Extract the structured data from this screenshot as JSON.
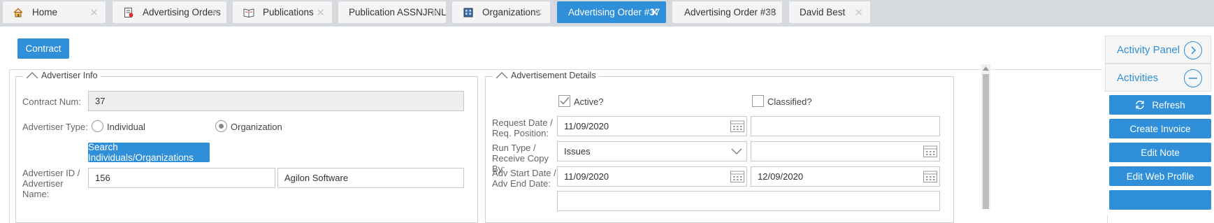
{
  "tabs": [
    {
      "label": "Home",
      "icon": "home-icon"
    },
    {
      "label": "Advertising Orders",
      "icon": "orders-icon"
    },
    {
      "label": "Publications",
      "icon": "publications-icon"
    },
    {
      "label": "Publication ASSNJRNL",
      "icon": ""
    },
    {
      "label": "Organizations",
      "icon": "organizations-icon"
    },
    {
      "label": "Advertising Order #37",
      "icon": "",
      "active": true
    },
    {
      "label": "Advertising Order #38",
      "icon": ""
    },
    {
      "label": "David Best",
      "icon": ""
    }
  ],
  "toolbar": {
    "contract_label": "Contract"
  },
  "advertiser_info": {
    "legend": "Advertiser Info",
    "contract_num_label": "Contract Num:",
    "contract_num_value": "37",
    "advertiser_type_label": "Advertiser Type:",
    "type_individual": "Individual",
    "type_organization": "Organization",
    "selected_type": "Organization",
    "search_button": "Search Individuals/Organizations",
    "advertiser_id_label": "Advertiser ID / Advertiser Name:",
    "advertiser_id_value": "156",
    "advertiser_name_value": "Agilon Software"
  },
  "ad_details": {
    "legend": "Advertisement Details",
    "active_label": "Active?",
    "active_checked": true,
    "classified_label": "Classified?",
    "classified_checked": false,
    "request_date_label": "Request Date / Req. Position:",
    "request_date_value": "11/09/2020",
    "req_position_value": "",
    "run_type_label": "Run Type / Receive Copy By:",
    "run_type_value": "Issues",
    "receive_copy_value": "",
    "adv_dates_label": "Adv Start Date / Adv End Date:",
    "adv_start_value": "11/09/2020",
    "adv_end_value": "12/09/2020"
  },
  "side_panel": {
    "activity_panel_label": "Activity Panel",
    "activities_label": "Activities",
    "buttons": [
      "Refresh",
      "Create Invoice",
      "Edit Note",
      "Edit Web Profile"
    ]
  },
  "colors": {
    "accent": "#2f8fd8",
    "tabbar": "#d6d9de"
  }
}
